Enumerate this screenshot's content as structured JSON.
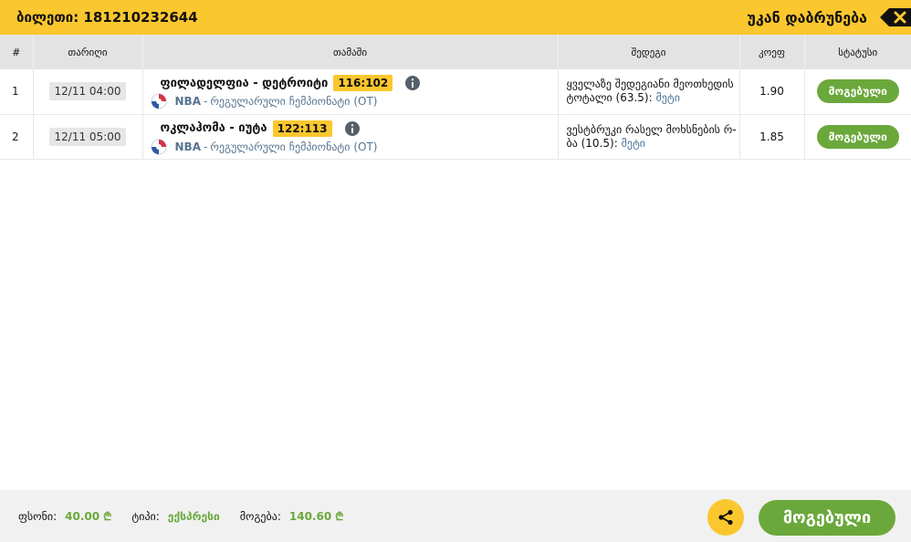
{
  "header": {
    "title": "ბილეთი: 181210232644",
    "back_label": "უკან დაბრუნება"
  },
  "table": {
    "columns": [
      "#",
      "თარიღი",
      "თამაში",
      "შედეგი",
      "კოეფ",
      "სტატუსი"
    ],
    "rows": [
      {
        "num": "1",
        "date": "12/11 04:00",
        "game": "ფილადელფია - დეტროიტი",
        "score": "116:102",
        "league": "NBA",
        "league_sep": "-",
        "league_desc": "რეგულარული ჩემპიონატი (OT)",
        "result": "ყველაზე შედეგიანი მეოთხედის ტოტალი (63.5):",
        "more": "მეტი",
        "odd": "1.90",
        "status": "მოგებული"
      },
      {
        "num": "2",
        "date": "12/11 05:00",
        "game": "ოკლაჰომა - იუტა",
        "score": "122:113",
        "league": "NBA",
        "league_sep": "-",
        "league_desc": "რეგულარული ჩემპიონატი (OT)",
        "result": "ვესტბრუკი რასელ მოხსნების რ-ბა (10.5):",
        "more": "მეტი",
        "odd": "1.85",
        "status": "მოგებული"
      }
    ]
  },
  "footer": {
    "stake_label": "ფსონი:",
    "stake_value": "40.00",
    "type_label": "ტიპი:",
    "type_value": "ექსპრესი",
    "win_label": "მოგება:",
    "win_value": "140.60",
    "currency_symbol": "₾",
    "status": "მოგებული"
  },
  "icons": {
    "back": "backspace-close-icon",
    "info": "info-icon",
    "league": "nba-logo-icon",
    "share": "share-icon"
  },
  "colors": {
    "accent": "#fbc72e",
    "success": "#6ba83b",
    "link": "#56738e"
  }
}
